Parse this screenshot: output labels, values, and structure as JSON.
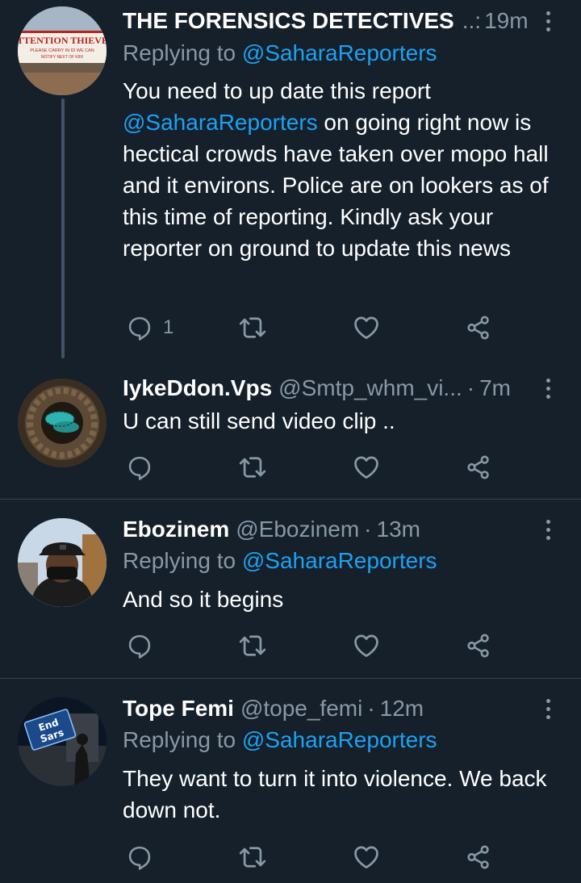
{
  "tweets": [
    {
      "name": "THE FORENSICS DETECTIVES",
      "handle": "..:",
      "time": "19m",
      "replying_prefix": "Replying to",
      "replying_to": "@SaharaReporters",
      "text_before": "You need to up date this report ",
      "text_mention": "@SaharaReporters",
      "text_after": " on going right now is hectical crowds have taken over mopo hall and it environs. Police are on lookers as of this time of reporting. Kindly ask your reporter on ground to update this news",
      "reply_count": "1",
      "avatar_sign": {
        "line1": "ATTENTION THIEVES",
        "line2": "PLEASE CARRY IN ID WE CAN",
        "line3": "NOTIFY NEXT OF KIN!"
      }
    },
    {
      "name": "IykeDdon.Vps",
      "handle": "@Smtp_whm_vi...",
      "time": "7m",
      "text": "U can still send video clip ..",
      "reply_count": ""
    },
    {
      "name": "Ebozinem",
      "handle": "@Ebozinem",
      "time": "13m",
      "replying_prefix": "Replying to",
      "replying_to": "@SaharaReporters",
      "text": "And so it begins",
      "reply_count": ""
    },
    {
      "name": "Tope Femi",
      "handle": "@tope_femi",
      "time": "12m",
      "replying_prefix": "Replying to",
      "replying_to": "@SaharaReporters",
      "text": "They want to turn it into violence. We back down not.",
      "reply_count": "",
      "avatar_sign": {
        "line1": "End",
        "line2": "Sars"
      }
    }
  ],
  "separator": "·",
  "colors": {
    "background": "#15202b",
    "text": "#ffffff",
    "secondary": "#8899a6",
    "accent": "#1da1f2",
    "divider": "#38444d"
  },
  "icons": [
    "reply-icon",
    "retweet-icon",
    "like-icon",
    "share-icon",
    "more-icon"
  ]
}
